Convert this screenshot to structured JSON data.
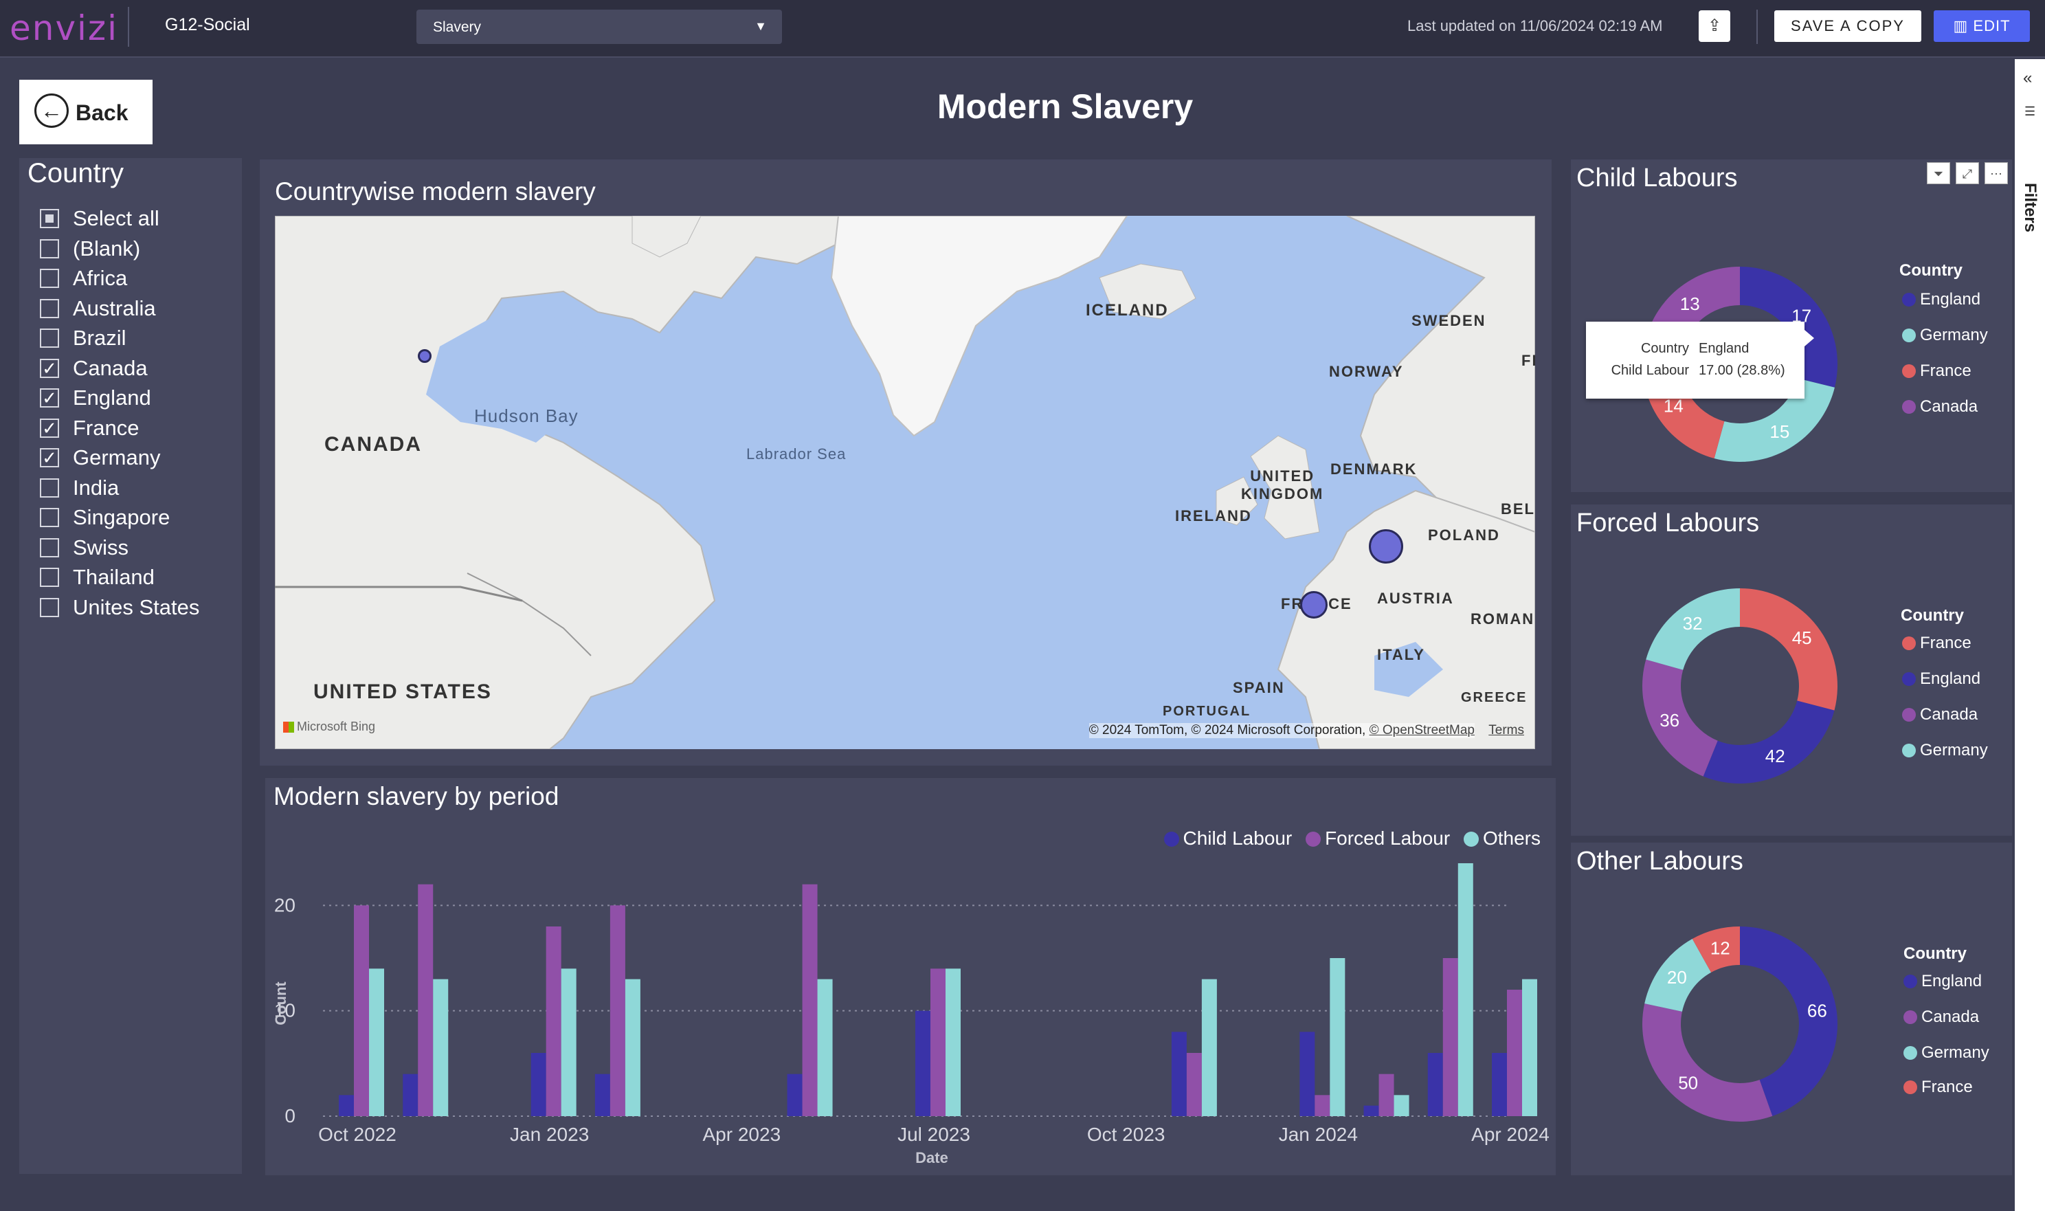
{
  "topbar": {
    "logo": "envizi",
    "workspace": "G12-Social",
    "report_select": "Slavery",
    "last_updated": "Last updated on 11/06/2024 02:19 AM",
    "save_copy_label": "SAVE A COPY",
    "edit_label": "EDIT"
  },
  "filters_label": "Filters",
  "back_label": "Back",
  "page_title": "Modern Slavery",
  "slicer": {
    "title": "Country",
    "items": [
      {
        "label": "Select all",
        "state": "partial"
      },
      {
        "label": "(Blank)",
        "state": "unchecked"
      },
      {
        "label": "Africa",
        "state": "unchecked"
      },
      {
        "label": "Australia",
        "state": "unchecked"
      },
      {
        "label": "Brazil",
        "state": "unchecked"
      },
      {
        "label": "Canada",
        "state": "checked"
      },
      {
        "label": "England",
        "state": "checked"
      },
      {
        "label": "France",
        "state": "checked"
      },
      {
        "label": "Germany",
        "state": "checked"
      },
      {
        "label": "India",
        "state": "unchecked"
      },
      {
        "label": "Singapore",
        "state": "unchecked"
      },
      {
        "label": "Swiss",
        "state": "unchecked"
      },
      {
        "label": "Thailand",
        "state": "unchecked"
      },
      {
        "label": "Unites States",
        "state": "unchecked"
      }
    ]
  },
  "map": {
    "title": "Countrywise modern slavery",
    "labels": {
      "iceland": "ICELAND",
      "sweden": "SWEDEN",
      "finland": "FINLA",
      "norway": "NORWAY",
      "hudson": "Hudson Bay",
      "labrador": "Labrador Sea",
      "canada": "CANADA",
      "uk": "UNITED\nKINGDOM",
      "denmark": "DENMARK",
      "ireland": "IRELAND",
      "belarus": "BELA",
      "poland": "POLAND",
      "france": "FRANCE",
      "austria": "AUSTRIA",
      "romania": "ROMAN",
      "italy": "ITALY",
      "spain": "SPAIN",
      "portugal": "PORTUGAL",
      "greece": "GREECE",
      "us": "UNITED STATES"
    },
    "attribution": "© 2024 TomTom, © 2024 Microsoft Corporation,",
    "osm": "© OpenStreetMap",
    "terms": "Terms",
    "bing": "Microsoft Bing"
  },
  "colors": {
    "child": "#3a33a8",
    "forced": "#9050a8",
    "others": "#8fd8d8",
    "france": "#e06060",
    "background": "#3b3d52",
    "panel": "#45475e"
  },
  "bar_chart": {
    "title": "Modern slavery by period",
    "legend": [
      "Child Labour",
      "Forced Labour",
      "Others"
    ]
  },
  "chart_data": [
    {
      "type": "bar",
      "title": "Modern slavery by period",
      "xlabel": "Date",
      "ylabel": "Count",
      "ylim": [
        0,
        24
      ],
      "yticks": [
        0,
        10,
        20
      ],
      "x_tick_labels": [
        "Oct 2022",
        "Jan 2023",
        "Apr 2023",
        "Jul 2023",
        "Oct 2023",
        "Jan 2024",
        "Apr 2024"
      ],
      "x_dates": [
        "2022-10",
        "2022-11",
        "2023-01",
        "2023-02",
        "2023-05",
        "2023-07",
        "2023-11",
        "2024-01",
        "2024-02",
        "2024-03",
        "2024-04"
      ],
      "series": [
        {
          "name": "Child Labour",
          "values": [
            2,
            4,
            6,
            4,
            4,
            10,
            8,
            8,
            1,
            6,
            6
          ]
        },
        {
          "name": "Forced Labour",
          "values": [
            20,
            22,
            18,
            20,
            22,
            14,
            6,
            2,
            4,
            15,
            12
          ]
        },
        {
          "name": "Others",
          "values": [
            14,
            13,
            14,
            13,
            13,
            14,
            13,
            15,
            2,
            24,
            13
          ]
        }
      ],
      "grid": true,
      "legend_position": "top-right"
    },
    {
      "type": "pie",
      "title": "Child Labours",
      "legend_title": "Country",
      "legend": [
        "England",
        "Germany",
        "France",
        "Canada"
      ],
      "slices": [
        {
          "label": "England",
          "value": 17
        },
        {
          "label": "Germany",
          "value": 15
        },
        {
          "label": "France",
          "value": 14
        },
        {
          "label": "Canada",
          "value": 13
        }
      ]
    },
    {
      "type": "pie",
      "title": "Forced Labours",
      "legend_title": "Country",
      "legend": [
        "France",
        "England",
        "Canada",
        "Germany"
      ],
      "slices": [
        {
          "label": "France",
          "value": 45
        },
        {
          "label": "England",
          "value": 42
        },
        {
          "label": "Canada",
          "value": 36
        },
        {
          "label": "Germany",
          "value": 32
        }
      ]
    },
    {
      "type": "pie",
      "title": "Other Labours",
      "legend_title": "Country",
      "legend": [
        "England",
        "Canada",
        "Germany",
        "France"
      ],
      "slices": [
        {
          "label": "England",
          "value": 66
        },
        {
          "label": "Canada",
          "value": 50
        },
        {
          "label": "Germany",
          "value": 20
        },
        {
          "label": "France",
          "value": 12
        }
      ]
    }
  ],
  "tooltip": {
    "country_key": "Country",
    "country_val": "England",
    "measure_key": "Child Labour",
    "measure_val": "17.00 (28.8%)"
  }
}
